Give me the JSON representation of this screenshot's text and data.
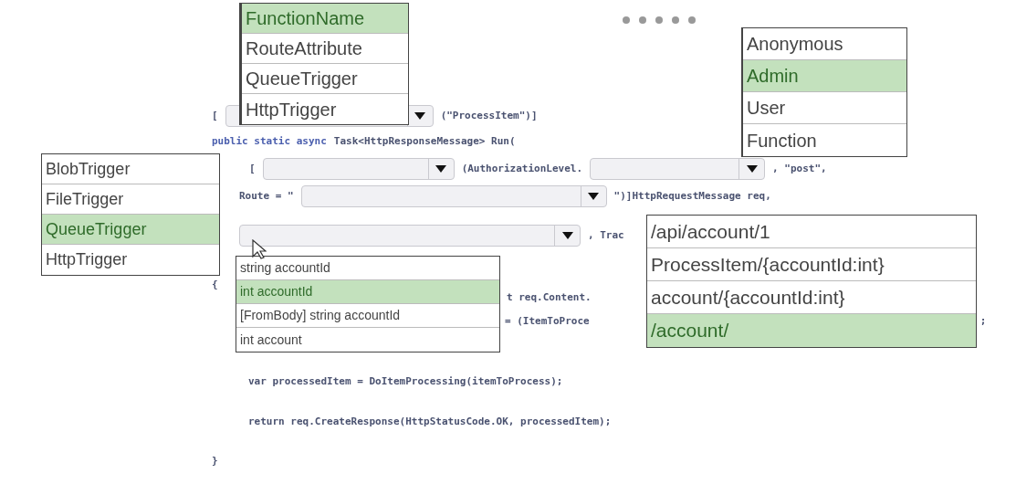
{
  "code_lines": [
    {
      "parts": [
        {
          "kind": "code",
          "text": "["
        },
        {
          "kind": "dropdown"
        },
        {
          "kind": "code",
          "text": "(\"ProcessItem\")]"
        }
      ]
    },
    {
      "parts": [
        {
          "kind": "keyword",
          "text": "public static async"
        },
        {
          "kind": "code",
          "text": "Task<HttpResponseMessage> Run("
        }
      ]
    },
    {
      "parts": [
        {
          "kind": "code",
          "text": "["
        },
        {
          "kind": "dropdown"
        },
        {
          "kind": "code",
          "text": "(AuthorizationLevel."
        },
        {
          "kind": "dropdown"
        },
        {
          "kind": "code",
          "text": ", \"post\","
        }
      ]
    },
    {
      "parts": [
        {
          "kind": "code",
          "text": "Route = \""
        },
        {
          "kind": "dropdown"
        },
        {
          "kind": "code",
          "text": "\")]HttpRequestMessage req,"
        }
      ]
    },
    {
      "parts": [
        {
          "kind": "dropdown"
        },
        {
          "kind": "code",
          "text": ", Trac"
        }
      ]
    },
    {
      "parts": [
        {
          "kind": "code",
          "text": "{"
        }
      ]
    },
    {
      "parts": [
        {
          "kind": "code",
          "text": "t req.Content."
        }
      ]
    },
    {
      "parts": [
        {
          "kind": "code",
          "text": "= (ItemToProce"
        },
        {
          "kind": "code",
          "text": ";"
        }
      ]
    },
    {
      "parts": [
        {
          "kind": "code",
          "text": "var processedItem = DoItemProcessing(itemToProcess);"
        }
      ]
    },
    {
      "parts": [
        {
          "kind": "code",
          "text": "return req.CreateResponse(HttpStatusCode.OK, processedItem);"
        }
      ]
    },
    {
      "parts": [
        {
          "kind": "code",
          "text": "}"
        }
      ]
    }
  ],
  "answer_lists": [
    {
      "items": [
        {
          "text": "FunctionName",
          "selected": true
        },
        {
          "text": "RouteAttribute",
          "selected": false
        },
        {
          "text": "QueueTrigger",
          "selected": false
        },
        {
          "text": "HttpTrigger",
          "selected": false
        }
      ]
    },
    {
      "items": [
        {
          "text": "Anonymous",
          "selected": false
        },
        {
          "text": "Admin",
          "selected": true
        },
        {
          "text": "User",
          "selected": false
        },
        {
          "text": "Function",
          "selected": false
        }
      ]
    },
    {
      "items": [
        {
          "text": "BlobTrigger",
          "selected": false
        },
        {
          "text": "FileTrigger",
          "selected": false
        },
        {
          "text": "QueueTrigger",
          "selected": true
        },
        {
          "text": "HttpTrigger",
          "selected": false
        }
      ]
    },
    {
      "items": [
        {
          "text": "string accountId",
          "selected": false
        },
        {
          "text": "int accountId",
          "selected": true
        },
        {
          "text": "[FromBody] string accountId",
          "selected": false
        },
        {
          "text": "int account",
          "selected": false
        }
      ]
    },
    {
      "items": [
        {
          "text": "/api/account/1",
          "selected": false
        },
        {
          "text": "ProcessItem/{accountId:int}",
          "selected": false
        },
        {
          "text": "account/{accountId:int}",
          "selected": false
        },
        {
          "text": "/account/",
          "selected": true
        }
      ]
    }
  ]
}
